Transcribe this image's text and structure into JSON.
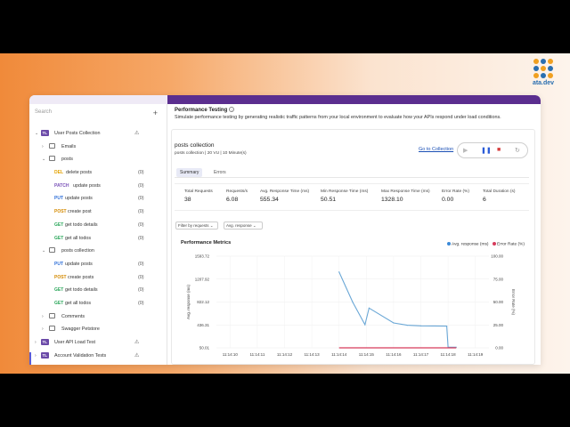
{
  "brand": {
    "name": "ata.dev"
  },
  "sidebar": {
    "search_placeholder": "Search",
    "add_icon": "plus-icon",
    "tree": [
      {
        "type": "collection",
        "label": "User Posts Collection",
        "badge": "TL",
        "chev": "⌄",
        "warn": true,
        "indent": 0
      },
      {
        "type": "folder",
        "label": "Emails",
        "chev": "›",
        "indent": 1
      },
      {
        "type": "folder",
        "label": "posts",
        "chev": "⌄",
        "indent": 1
      },
      {
        "type": "request",
        "method": "DEL",
        "label": "delete posts",
        "count": "(0)",
        "indent": 2
      },
      {
        "type": "request",
        "method": "PATCH",
        "label": "update posts",
        "count": "(0)",
        "indent": 2
      },
      {
        "type": "request",
        "method": "PUT",
        "label": "update posts",
        "count": "(0)",
        "indent": 2
      },
      {
        "type": "request",
        "method": "POST",
        "label": "create post",
        "count": "(0)",
        "indent": 2
      },
      {
        "type": "request",
        "method": "GET",
        "label": "get todo details",
        "count": "(0)",
        "indent": 2
      },
      {
        "type": "request",
        "method": "GET",
        "label": "get all todos",
        "count": "(0)",
        "indent": 2
      },
      {
        "type": "folder",
        "label": "posts collection",
        "chev": "⌄",
        "indent": 1
      },
      {
        "type": "request",
        "method": "PUT",
        "label": "update posts",
        "count": "(0)",
        "indent": 2
      },
      {
        "type": "request",
        "method": "POST",
        "label": "create posts",
        "count": "(0)",
        "indent": 2
      },
      {
        "type": "request",
        "method": "GET",
        "label": "get todo details",
        "count": "(0)",
        "indent": 2
      },
      {
        "type": "request",
        "method": "GET",
        "label": "get all todos",
        "count": "(0)",
        "indent": 2
      },
      {
        "type": "folder",
        "label": "Comments",
        "chev": "›",
        "indent": 1
      },
      {
        "type": "folder",
        "label": "Swagger Petstore",
        "chev": "›",
        "indent": 1
      },
      {
        "type": "collection",
        "label": "User API Load Test",
        "badge": "TL",
        "chev": "›",
        "warn": true,
        "indent": 0
      },
      {
        "type": "collection",
        "label": "Account Validation Tests",
        "badge": "TL",
        "chev": "›",
        "warn": true,
        "indent": 0
      }
    ]
  },
  "header": {
    "title": "Performance Testing",
    "description": "Simulate performance testing by generating realistic traffic patterns from your local environment to evaluate how your APIs respond under load conditions."
  },
  "collection": {
    "title": "posts collection",
    "subtitle": "posts collection  |  20 VU  |  10 Minute(s)",
    "goto_link": "Go to Collection",
    "controls": {
      "play_icon": "play-icon",
      "pause_icon": "pause-icon",
      "stop_icon": "stop-icon",
      "refresh_icon": "refresh-icon"
    }
  },
  "tabs": [
    {
      "label": "Summary",
      "active": true
    },
    {
      "label": "Errors",
      "active": false
    }
  ],
  "stats": [
    {
      "label": "Total Requests",
      "value": "38"
    },
    {
      "label": "Requests/s",
      "value": "6.08"
    },
    {
      "label": "Avg. Response Time (ms)",
      "value": "555.34"
    },
    {
      "label": "Min Response Time (ms)",
      "value": "50.51"
    },
    {
      "label": "Max Response Time (ms)",
      "value": "1328.10"
    },
    {
      "label": "Error Rate (%)",
      "value": "0.00"
    },
    {
      "label": "Total Duration (s)",
      "value": "6"
    }
  ],
  "filters": {
    "request": "Filter by requests  ⌄",
    "metric": "Avg. response  ⌄"
  },
  "chart_title": "Performance Metrics",
  "colors": {
    "response": "#6aa7d6",
    "error": "#d63b5b",
    "purple": "#5b2e8f"
  },
  "chart_data": {
    "type": "line",
    "x": [
      "11:14:10",
      "11:14:11",
      "11:14:12",
      "11:14:13",
      "11:14:14",
      "11:14:15",
      "11:14:16",
      "11:14:17",
      "11:14:18",
      "11:14:19"
    ],
    "y_left": {
      "label": "Avg. response (ms)",
      "ticks": [
        "50.01",
        "436.31",
        "822.12",
        "1207.92",
        "1593.72"
      ],
      "range": [
        50.01,
        1593.72
      ]
    },
    "y_right": {
      "label": "Error Rate (%)",
      "ticks": [
        "0.00",
        "25.00",
        "50.00",
        "75.00",
        "100.00"
      ],
      "range": [
        0,
        100
      ]
    },
    "series": [
      {
        "name": "Avg. response (ms)",
        "color": "#6aa7d6",
        "points": [
          [
            4.0,
            1328
          ],
          [
            4.5,
            820
          ],
          [
            4.95,
            440
          ],
          [
            5.1,
            720
          ],
          [
            6.0,
            470
          ],
          [
            6.5,
            430
          ],
          [
            7.0,
            420
          ],
          [
            7.95,
            415
          ],
          [
            8.0,
            60
          ],
          [
            8.3,
            60
          ]
        ]
      },
      {
        "name": "Error Rate (%)",
        "color": "#d63b5b",
        "points": [
          [
            4.0,
            0
          ],
          [
            8.3,
            0
          ]
        ]
      }
    ],
    "legend": "top-right"
  }
}
